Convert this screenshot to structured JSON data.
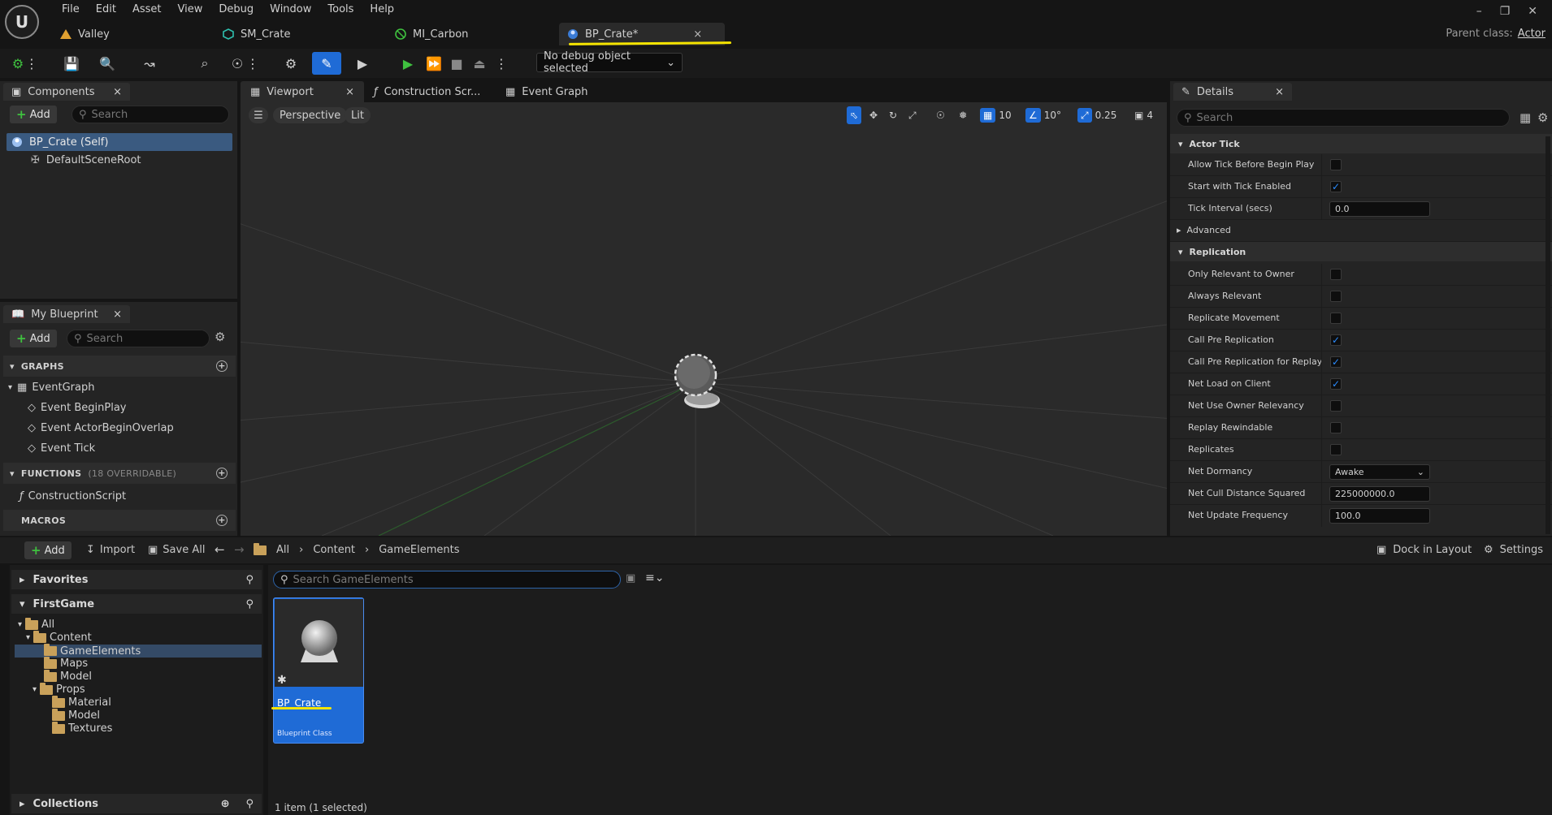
{
  "menu": [
    "File",
    "Edit",
    "Asset",
    "View",
    "Debug",
    "Window",
    "Tools",
    "Help"
  ],
  "doc_tabs": [
    {
      "label": "Valley",
      "icon": "level-icon",
      "color": "#e0a030"
    },
    {
      "label": "SM_Crate",
      "icon": "static-mesh-icon",
      "color": "#2fbfae"
    },
    {
      "label": "MI_Carbon",
      "icon": "material-instance-icon",
      "color": "#3fc13f"
    },
    {
      "label": "BP_Crate*",
      "icon": "blueprint-icon",
      "color": "#3a7bd5",
      "active": true,
      "close": "×"
    }
  ],
  "parent_class": {
    "label": "Parent class:",
    "value": "Actor"
  },
  "debug_select": "No debug object selected",
  "components": {
    "tab": "Components",
    "close": "×",
    "add": "Add",
    "search_placeholder": "Search",
    "self": "BP_Crate (Self)",
    "root": "DefaultSceneRoot"
  },
  "my_blueprint": {
    "tab": "My Blueprint",
    "close": "×",
    "add": "Add",
    "search_placeholder": "Search",
    "graphs_header": "GRAPHS",
    "event_graph": "EventGraph",
    "events": [
      "Event BeginPlay",
      "Event ActorBeginOverlap",
      "Event Tick"
    ],
    "functions_header": "FUNCTIONS",
    "functions_count": "(18 OVERRIDABLE)",
    "construction_script": "ConstructionScript",
    "macros_header": "MACROS"
  },
  "editor_tabs": [
    {
      "label": "Viewport",
      "active": true,
      "close": "×"
    },
    {
      "label": "Construction Scr..."
    },
    {
      "label": "Event Graph"
    }
  ],
  "viewport": {
    "perspective": "Perspective",
    "lit": "Lit",
    "grid_snap": "10",
    "rot_snap": "10°",
    "scale_snap": "0.25",
    "cam_speed": "4"
  },
  "details": {
    "tab": "Details",
    "close": "×",
    "search_placeholder": "Search",
    "actor_tick_header": "Actor Tick",
    "allow_tick": "Allow Tick Before Begin Play",
    "start_tick": "Start with Tick Enabled",
    "tick_interval": "Tick Interval (secs)",
    "tick_interval_val": "0.0",
    "advanced": "Advanced",
    "replication_header": "Replication",
    "rep_rows": [
      {
        "label": "Only Relevant to Owner",
        "checked": false
      },
      {
        "label": "Always Relevant",
        "checked": false
      },
      {
        "label": "Replicate Movement",
        "checked": false
      },
      {
        "label": "Call Pre Replication",
        "checked": true
      },
      {
        "label": "Call Pre Replication for Replay",
        "checked": true
      },
      {
        "label": "Net Load on Client",
        "checked": true
      },
      {
        "label": "Net Use Owner Relevancy",
        "checked": false
      },
      {
        "label": "Replay Rewindable",
        "checked": false
      },
      {
        "label": "Replicates",
        "checked": false
      }
    ],
    "net_dormancy": "Net Dormancy",
    "net_dormancy_val": "Awake",
    "net_cull": "Net Cull Distance Squared",
    "net_cull_val": "225000000.0",
    "net_update": "Net Update Frequency",
    "net_update_val": "100.0",
    "check": "✓"
  },
  "content_browser": {
    "add": "Add",
    "import": "Import",
    "save_all": "Save All",
    "path": [
      "All",
      "Content",
      "GameElements"
    ],
    "dock": "Dock in Layout",
    "settings": "Settings",
    "favorites": "Favorites",
    "project": "FirstGame",
    "collections": "Collections",
    "folders": [
      "All",
      "Content",
      "GameElements",
      "Maps",
      "Model",
      "Props",
      "Material",
      "Model",
      "Textures"
    ],
    "search_placeholder": "Search GameElements",
    "asset_name": "BP_Crate",
    "asset_type": "Blueprint Class",
    "status": "1 item (1 selected)"
  }
}
